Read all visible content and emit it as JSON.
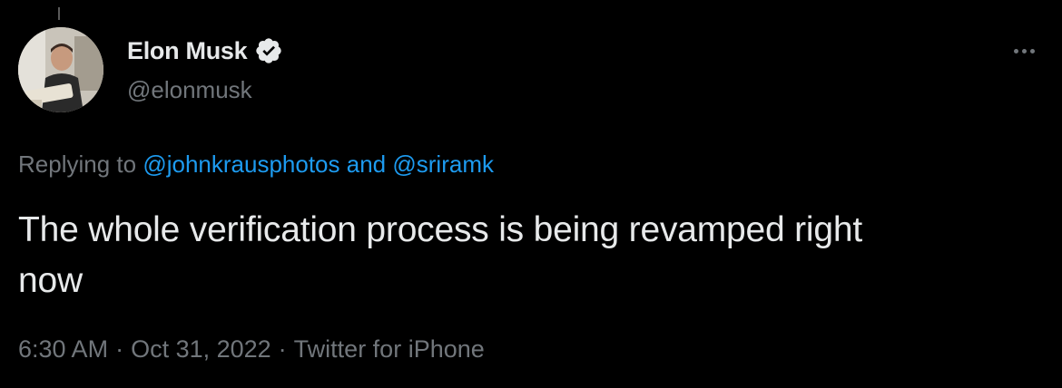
{
  "tweet": {
    "author": {
      "display_name": "Elon Musk",
      "handle": "@elonmusk",
      "verified": true,
      "verified_icon": "verified-badge-icon",
      "avatar": "profile-photo"
    },
    "reply_context": {
      "prefix": "Replying to",
      "users": [
        "@johnkrausphotos",
        "@sriramk"
      ],
      "conjunction": "and"
    },
    "text_line_1": "The whole verification process is being revamped right",
    "text_line_2": "now",
    "meta": {
      "time": "6:30 AM",
      "date": "Oct 31, 2022",
      "source": "Twitter for iPhone",
      "separator": "·"
    },
    "more_icon": "more-options-icon"
  },
  "colors": {
    "background": "#000000",
    "text_primary": "#e7e9ea",
    "text_secondary": "#71767b",
    "link": "#1d9bf0",
    "verified_badge": "#e7e9ea"
  }
}
